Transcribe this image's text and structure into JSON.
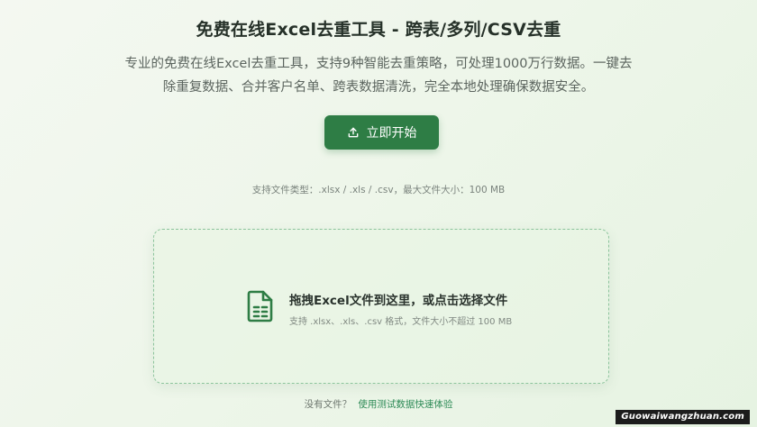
{
  "page": {
    "title": "免费在线Excel去重工具 - 跨表/多列/CSV去重",
    "subtitle_line1": "专业的免费在线Excel去重工具，支持9种智能去重策略，可处理1000万行数据。一键去",
    "subtitle_line2": "除重复数据、合并客户名单、跨表数据清洗，完全本地处理确保数据安全。"
  },
  "actions": {
    "start_label": "立即开始",
    "start_icon": "upload-icon"
  },
  "support_note": "支持文件类型：.xlsx / .xls / .csv，最大文件大小：100 MB",
  "dropzone": {
    "icon": "spreadsheet-file-icon",
    "main_text": "拖拽Excel文件到这里，或点击选择文件",
    "sub_text": "支持 .xlsx、.xls、.csv 格式，文件大小不超过 100 MB"
  },
  "demo": {
    "prompt": "没有文件？",
    "link_text": "使用测试数据快速体验"
  },
  "watermark": "Guowaiwangzhuan.com",
  "colors": {
    "accent": "#2e7d45",
    "link": "#2e8b57",
    "dropzone_border": "#8cc49c"
  }
}
